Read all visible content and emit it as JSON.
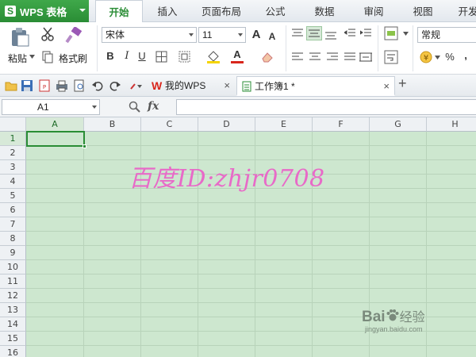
{
  "app": {
    "name": "WPS 表格",
    "logo": "S"
  },
  "menu_tabs": [
    "开始",
    "插入",
    "页面布局",
    "公式",
    "数据",
    "审阅",
    "视图",
    "开发"
  ],
  "ribbon": {
    "paste_label": "粘贴",
    "format_painter_label": "格式刷",
    "font_name": "宋体",
    "font_size": "11",
    "number_format": "常规",
    "bold": "B",
    "italic": "I",
    "underline": "U",
    "grow_font": "A",
    "shrink_font": "A",
    "font_color_glyph": "A",
    "percent": "%",
    "comma": ","
  },
  "doc_tabs": [
    {
      "label": "我的WPS",
      "icon": "wps-logo-icon",
      "close": "×"
    },
    {
      "label": "工作簿1 *",
      "icon": "sheet-icon",
      "close": "×"
    }
  ],
  "add_tab": "+",
  "formula_bar": {
    "cell_ref": "A1",
    "fx": "fx",
    "value": ""
  },
  "grid": {
    "columns": [
      "A",
      "B",
      "C",
      "D",
      "E",
      "F",
      "G",
      "H"
    ],
    "rows": [
      "1",
      "2",
      "3",
      "4",
      "5",
      "6",
      "7",
      "8",
      "9",
      "10",
      "11",
      "12",
      "13",
      "14",
      "15",
      "16"
    ],
    "selected_cell": "A1"
  },
  "watermark": "百度ID:zhjr0708",
  "baidu_logo": {
    "text": "Bai",
    "cn": "经验",
    "sub": "jingyan.baidu.com"
  },
  "colors": {
    "accent": "#2a8d35",
    "grid_bg": "#cde7cf",
    "watermark": "#e86ac8"
  }
}
